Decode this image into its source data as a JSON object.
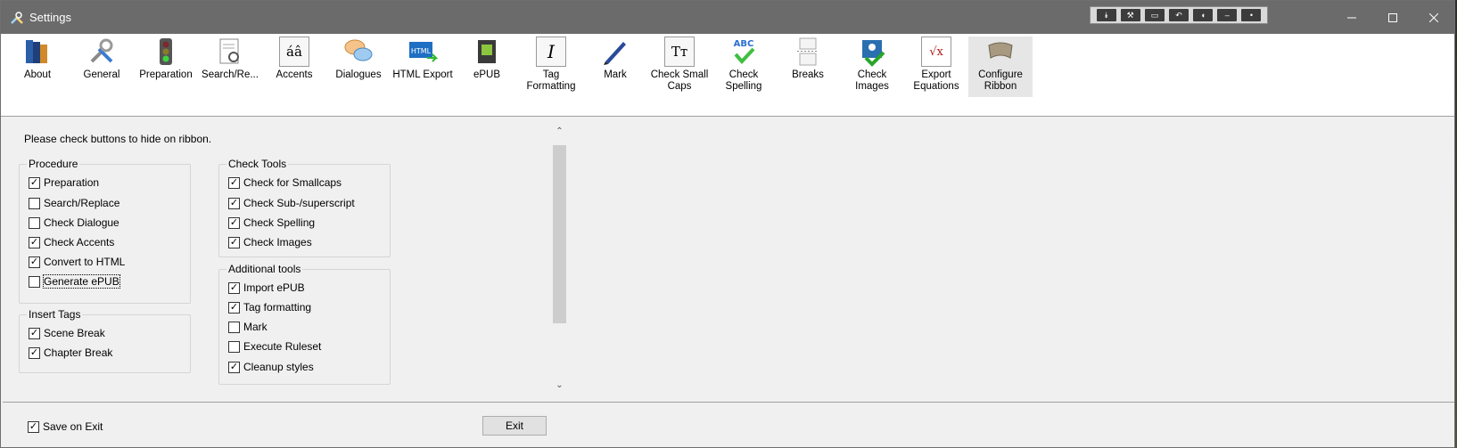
{
  "window": {
    "title": "Settings"
  },
  "floating_toolbar": {
    "icons": [
      "chevrons-down-icon",
      "wrench-icon",
      "panel-icon",
      "undo-icon",
      "mic-icon",
      "minus-icon",
      "dot-icon"
    ]
  },
  "ribbon": {
    "items": [
      {
        "label": "About",
        "icon": "books-icon"
      },
      {
        "label": "General",
        "icon": "tools-icon"
      },
      {
        "label": "Preparation",
        "icon": "traffic-light-icon"
      },
      {
        "label": "Search/Re...",
        "icon": "document-search-icon"
      },
      {
        "label": "Accents",
        "icon": "accents-icon"
      },
      {
        "label": "Dialogues",
        "icon": "speech-bubbles-icon"
      },
      {
        "label": "HTML Export",
        "icon": "html-icon"
      },
      {
        "label": "ePUB",
        "icon": "epub-icon"
      },
      {
        "label": "Tag Formatting",
        "icon": "italic-icon"
      },
      {
        "label": "Mark",
        "icon": "pen-icon"
      },
      {
        "label": "Check Small Caps",
        "icon": "small-caps-icon"
      },
      {
        "label": "Check Spelling",
        "icon": "spell-check-icon"
      },
      {
        "label": "Breaks",
        "icon": "page-break-icon"
      },
      {
        "label": "Check Images",
        "icon": "image-check-icon"
      },
      {
        "label": "Export Equations",
        "icon": "equation-icon"
      },
      {
        "label": "Configure Ribbon",
        "icon": "ribbon-icon"
      }
    ]
  },
  "content": {
    "instruction": "Please check buttons to hide on ribbon.",
    "procedure": {
      "title": "Procedure",
      "items": [
        {
          "label": "Preparation",
          "checked": true
        },
        {
          "label": "Search/Replace",
          "checked": false
        },
        {
          "label": "Check Dialogue",
          "checked": false
        },
        {
          "label": "Check Accents",
          "checked": true
        },
        {
          "label": "Convert to HTML",
          "checked": true
        },
        {
          "label": "Generate ePUB",
          "checked": false
        }
      ]
    },
    "insert_tags": {
      "title": "Insert Tags",
      "items": [
        {
          "label": "Scene Break",
          "checked": true
        },
        {
          "label": "Chapter Break",
          "checked": true
        }
      ]
    },
    "check_tools": {
      "title": "Check Tools",
      "items": [
        {
          "label": "Check for Smallcaps",
          "checked": true
        },
        {
          "label": "Check Sub-/superscript",
          "checked": true
        },
        {
          "label": "Check Spelling",
          "checked": true
        },
        {
          "label": "Check Images",
          "checked": true
        }
      ]
    },
    "additional_tools": {
      "title": "Additional tools",
      "items": [
        {
          "label": "Import ePUB",
          "checked": true
        },
        {
          "label": "Tag formatting",
          "checked": true
        },
        {
          "label": "Mark",
          "checked": false
        },
        {
          "label": "Execute Ruleset",
          "checked": false
        },
        {
          "label": "Cleanup styles",
          "checked": true
        }
      ]
    }
  },
  "footer": {
    "save_on_exit": {
      "label": "Save on Exit",
      "checked": true
    },
    "exit_label": "Exit"
  }
}
